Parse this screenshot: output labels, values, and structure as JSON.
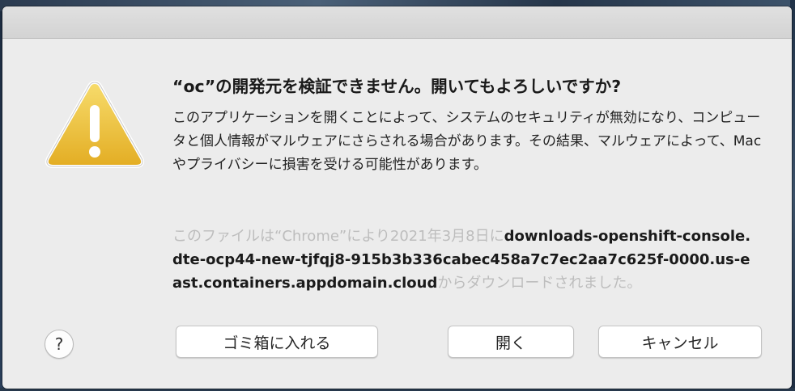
{
  "dialog": {
    "title": "“oc”の開発元を検証できません。開いてもよろしいですか?",
    "message": "このアプリケーションを開くことによって、システムのセキュリティが無効になり、コンピュータと個人情報がマルウェアにさらされる場合があります。その結果、マルウェアによって、Macやプライバシーに損害を受ける可能性があります。",
    "source_prefix": "このファイルは“Chrome”により2021年3月8日に",
    "source_host": "downloads-openshift-console.dte-ocp44-new-tjfqj8-915b3b336cabec458a7c7ec2aa7c625f-0000.us-east.containers.appdomain.cloud",
    "source_suffix": "からダウンロードされました。",
    "icon": "warning-triangle-icon"
  },
  "buttons": {
    "help": "?",
    "trash": "ゴミ箱に入れる",
    "open": "開く",
    "cancel": "キャンセル"
  },
  "colors": {
    "dialog_bg": "#ececec",
    "warning_yellow": "#f0c53a",
    "muted_text": "#bdbdbd"
  }
}
